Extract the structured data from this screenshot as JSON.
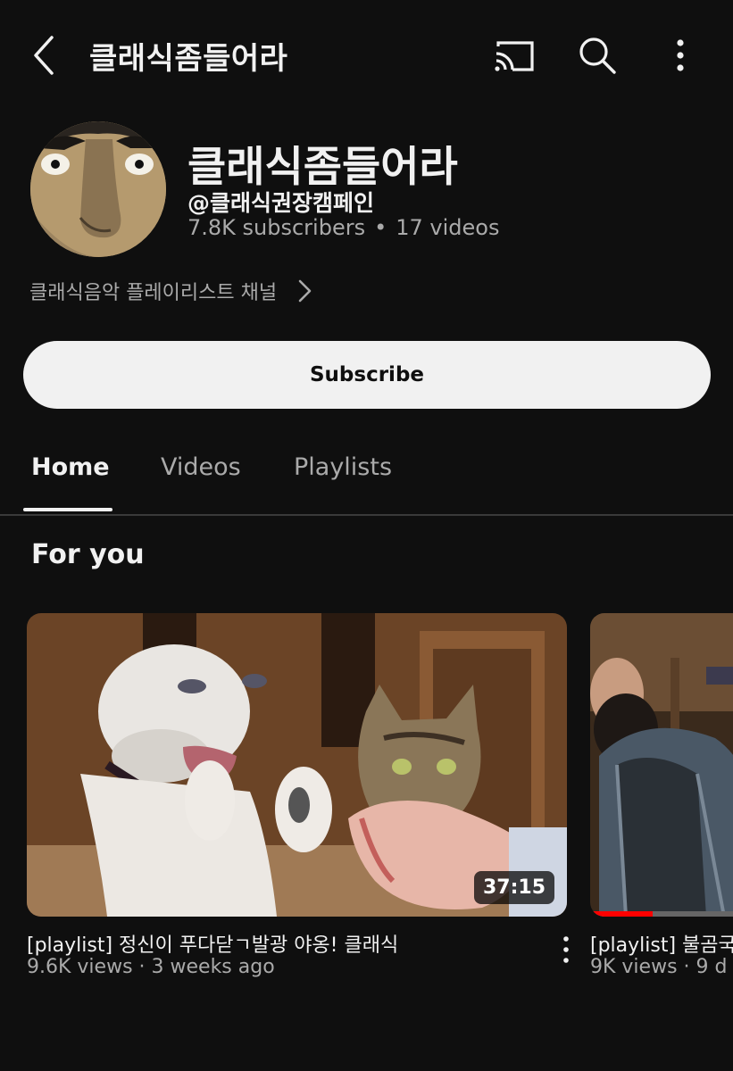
{
  "header": {
    "title": "클래식좀들어라",
    "back_icon": "chevron-left-icon",
    "cast_icon": "cast-icon",
    "search_icon": "search-icon",
    "more_icon": "more-vert-icon"
  },
  "channel": {
    "name": "클래식좀들어라",
    "handle": "@클래식권장캠페인",
    "subscribers": "7.8K subscribers",
    "separator": "•",
    "videos": "17 videos",
    "description": "클래식음악 플레이리스트 채널",
    "subscribe_label": "Subscribe"
  },
  "tabs": [
    {
      "label": "Home",
      "active": true
    },
    {
      "label": "Videos",
      "active": false
    },
    {
      "label": "Playlists",
      "active": false
    }
  ],
  "section": {
    "title": "For you"
  },
  "videos": [
    {
      "title": "[playlist] 정신이 푸다닫ㄱ발광 야옹! 클래식",
      "meta": "9.6K views · 3 weeks ago",
      "duration": "37:15"
    },
    {
      "title": "[playlist] 불곰국",
      "meta": "9K views · 9 d",
      "watched_fraction": 0.35
    }
  ],
  "colors": {
    "background": "#0f0f0f",
    "text": "#f1f1f1",
    "secondary": "#aaaaaa",
    "progress": "#ff0000"
  }
}
